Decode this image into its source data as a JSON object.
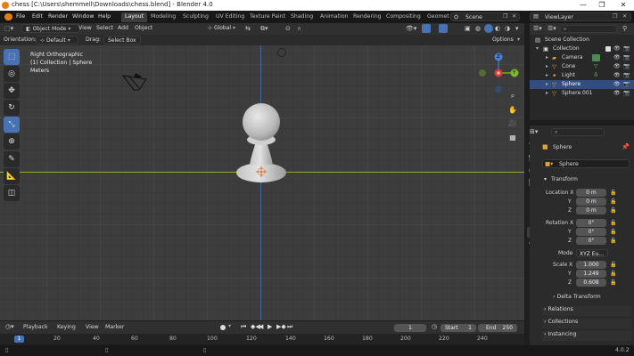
{
  "titlebar": {
    "title": "chess [C:\\Users\\shemmell\\Downloads\\chess.blend] - Blender 4.0",
    "minimize": "—",
    "maximize": "❐",
    "close": "✕"
  },
  "menus": [
    "File",
    "Edit",
    "Render",
    "Window",
    "Help"
  ],
  "workspaces": [
    "Layout",
    "Modeling",
    "Sculpting",
    "UV Editing",
    "Texture Paint",
    "Shading",
    "Animation",
    "Rendering",
    "Compositing",
    "Geomet"
  ],
  "scene": {
    "name": "Scene",
    "view_layer": "ViewLayer"
  },
  "viewport_header": {
    "mode": "Object Mode",
    "menus": [
      "View",
      "Select",
      "Add",
      "Object"
    ],
    "transform_orientation": "Global"
  },
  "tool_header": {
    "orientation_label": "Orientation:",
    "orientation_value": "Default",
    "drag_label": "Drag:",
    "drag_value": "Select Box",
    "options": "Options"
  },
  "viewport_info": {
    "view": "Right Orthographic",
    "collection": "(1) Collection | Sphere",
    "units": "Meters"
  },
  "gizmo": {
    "z": "Z",
    "y": "Y"
  },
  "outliner": {
    "rows": [
      {
        "label": "Scene Collection",
        "icon": "collection-icon"
      },
      {
        "label": "Collection",
        "icon": "collection-icon"
      },
      {
        "label": "Camera",
        "icon": "camera-icon"
      },
      {
        "label": "Cone",
        "icon": "cone-icon"
      },
      {
        "label": "Light",
        "icon": "light-icon"
      },
      {
        "label": "Sphere",
        "icon": "mesh-icon"
      },
      {
        "label": "Sphere.001",
        "icon": "mesh-icon"
      }
    ]
  },
  "properties": {
    "object_name_top": "Sphere",
    "object_name": "Sphere",
    "transform_title": "Transform",
    "location_label": "Location X",
    "location": [
      "0 m",
      "0 m",
      "0 m"
    ],
    "rotation_label": "Rotation X",
    "rotation": [
      "0°",
      "0°",
      "0°"
    ],
    "mode_label": "Mode",
    "mode_value": "XYZ Eu...",
    "scale_label": "Scale X",
    "scale": [
      "1.000",
      "1.249",
      "0.608"
    ],
    "axis_y": "Y",
    "axis_z": "Z",
    "sections": [
      "Delta Transform",
      "Relations",
      "Collections",
      "Instancing"
    ]
  },
  "timeline": {
    "menus": [
      "Playback",
      "Keying",
      "View",
      "Marker"
    ],
    "current_frame": "1",
    "start_label": "Start",
    "start_value": "1",
    "end_label": "End",
    "end_value": "250",
    "ticks": [
      "1",
      "20",
      "40",
      "60",
      "80",
      "100",
      "120",
      "140",
      "160",
      "180",
      "200",
      "220",
      "240"
    ]
  },
  "status": {
    "version": "4.0.2"
  }
}
